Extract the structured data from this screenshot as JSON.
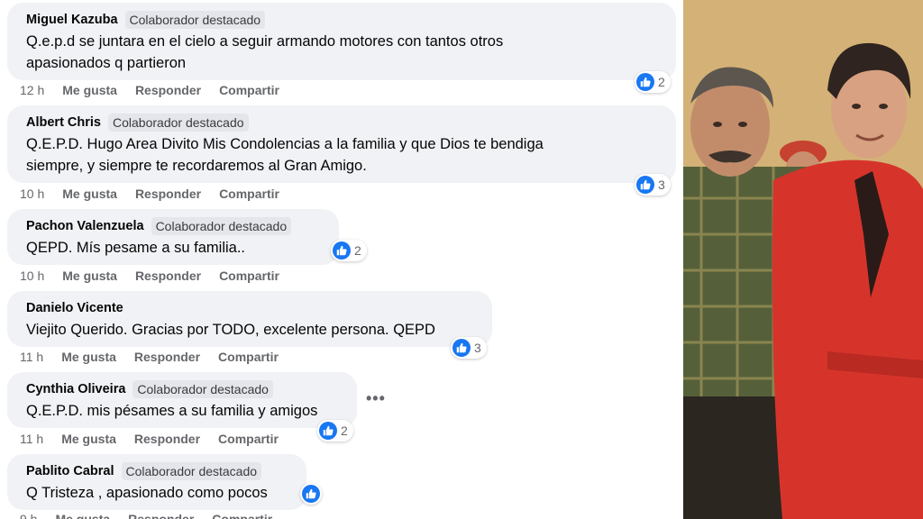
{
  "comments": [
    {
      "author": "Miguel Kazuba",
      "badge": "Colaborador destacado",
      "text_lines": [
        "Q.e.p.d se juntara en el cielo a seguir armando motores con tantos otros",
        "apasionados q partieron"
      ],
      "time": "12 h",
      "reactions": "2"
    },
    {
      "author": "Albert Chris",
      "badge": "Colaborador destacado",
      "text_lines": [
        "Q.E.P.D. Hugo Area Divito Mis Condolencias a la familia y que Dios te bendiga",
        "siempre, y siempre te recordaremos al Gran Amigo."
      ],
      "time": "10 h",
      "reactions": "3"
    },
    {
      "author": "Pachon Valenzuela",
      "badge": "Colaborador destacado",
      "text_lines": [
        "QEPD. Mís pesame a su familia.."
      ],
      "time": "10 h",
      "reactions": "2"
    },
    {
      "author": "Danielo Vicente",
      "text_lines": [
        "Viejito Querido. Gracias por TODO, excelente persona. QEPD"
      ],
      "time": "11 h",
      "reactions": "3"
    },
    {
      "author": "Cynthia Oliveira",
      "badge": "Colaborador destacado",
      "text_lines": [
        "Q.E.P.D. mis pésames a su familia y amigos"
      ],
      "time": "11 h",
      "reactions": "2"
    },
    {
      "author": "Pablito Cabral",
      "badge": "Colaborador destacado",
      "text_lines": [
        "Q Tristeza , apasionado como pocos"
      ],
      "time": "9 h"
    }
  ],
  "actions": {
    "like": "Me gusta",
    "reply": "Responder",
    "share": "Compartir"
  },
  "more_options": "•••",
  "colors": {
    "like_blue": "#1877f2",
    "bubble_bg": "#f0f2f5",
    "meta_gray": "#65676b"
  },
  "icons": [
    "like-thumb-icon",
    "more-options-icon"
  ]
}
